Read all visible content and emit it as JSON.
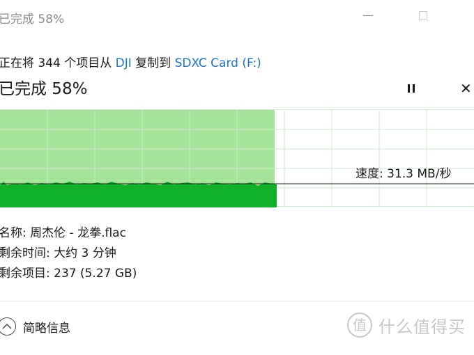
{
  "window": {
    "title": "已完成 58%"
  },
  "header": {
    "copy_prefix": "正在将 344 个项目从 ",
    "source": "DJI",
    "copy_middle": " 复制到 ",
    "destination": "SDXC Card (F:)"
  },
  "progress": {
    "label": "已完成 58%",
    "percent": 58
  },
  "graph": {
    "speed_text": "速度: 31.3 MB/秒"
  },
  "details": {
    "name_line": "名称: 周杰伦 - 龙拳.flac",
    "time_line": "剩余时间: 大约 3 分钟",
    "items_line": "剩余项目: 237 (5.27 GB)"
  },
  "footer": {
    "toggle_label": "简略信息",
    "watermark_text": "什么值得买"
  },
  "colors": {
    "progress_fill": "#a6e39a",
    "speed_fill": "#10b02a",
    "grid": "#cfe9cf",
    "link": "#1e73c8"
  },
  "icons": {
    "pause": "pause-icon",
    "close": "close-icon",
    "collapse": "chevron-up-icon",
    "watermark": "zhi-logo-icon"
  }
}
